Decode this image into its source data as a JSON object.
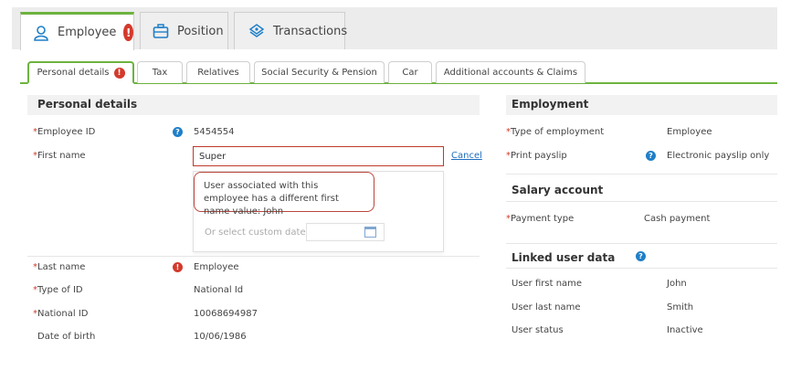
{
  "main_tabs": [
    {
      "label": "Employee",
      "has_error": true,
      "error_mark": "!",
      "icon": "person-icon"
    },
    {
      "label": "Position",
      "icon": "briefcase-icon"
    },
    {
      "label": "Transactions",
      "icon": "money-icon"
    }
  ],
  "sub_tabs": [
    {
      "label": "Personal details",
      "has_error": true,
      "error_mark": "!"
    },
    {
      "label": "Tax"
    },
    {
      "label": "Relatives"
    },
    {
      "label": "Social Security & Pension"
    },
    {
      "label": "Car"
    },
    {
      "label": "Additional accounts & Claims"
    }
  ],
  "personal": {
    "heading": "Personal details",
    "employee_id_label": "Employee ID",
    "employee_id_value": "5454554",
    "first_name_label": "First name",
    "first_name_value": "Super",
    "cancel_label": "Cancel",
    "tooltip_text": "User associated with this employee has a different first name value: John",
    "custom_date_placeholder": "Or select custom date",
    "last_name_label": "Last name",
    "last_name_value": "Employee",
    "type_of_id_label": "Type of ID",
    "type_of_id_value": "National Id",
    "national_id_label": "National ID",
    "national_id_value": "10068694987",
    "dob_label": "Date of birth",
    "dob_value": "10/06/1986"
  },
  "employment": {
    "heading": "Employment",
    "type_label": "Type of employment",
    "type_value": "Employee",
    "payslip_label": "Print payslip",
    "payslip_value": "Electronic payslip only"
  },
  "salary": {
    "heading": "Salary account",
    "payment_type_label": "Payment type",
    "payment_type_value": "Cash payment"
  },
  "linked": {
    "heading": "Linked user data",
    "first_name_label": "User first name",
    "first_name_value": "John",
    "last_name_label": "User last name",
    "last_name_value": "Smith",
    "status_label": "User status",
    "status_value": "Inactive"
  },
  "symbols": {
    "required": "*",
    "help": "?",
    "error": "!"
  },
  "colors": {
    "accent_green": "#6db33f",
    "error_red": "#d33a2c",
    "help_blue": "#1f7fc8",
    "link_blue": "#1f6fbf"
  }
}
